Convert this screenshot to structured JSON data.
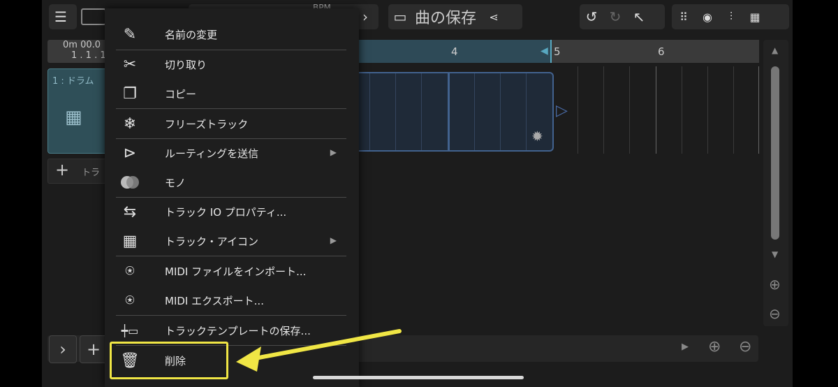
{
  "toolbar": {
    "song_title": "曲の保存",
    "bpm_label": "BPM"
  },
  "time": {
    "elapsed": "0m 00.0",
    "position": "1 . 1 . 1"
  },
  "ruler": {
    "marks": [
      "4",
      "5",
      "6"
    ]
  },
  "track": {
    "name": "1 : ドラム",
    "add_label": "トラ"
  },
  "menu": {
    "items": [
      {
        "label": "名前の変更",
        "icon": "pencil-icon"
      },
      {
        "label": "切り取り",
        "icon": "scissors-icon"
      },
      {
        "label": "コピー",
        "icon": "copy-icon"
      },
      {
        "label": "フリーズトラック",
        "icon": "snowflake-icon"
      },
      {
        "label": "ルーティングを送信",
        "icon": "routing-icon",
        "submenu": true
      },
      {
        "label": "モノ",
        "icon": "mono-icon"
      },
      {
        "label": "トラック IO プロパティ...",
        "icon": "io-cable-icon"
      },
      {
        "label": "トラック・アイコン",
        "icon": "grid-icon",
        "submenu": true
      },
      {
        "label": "MIDI ファイルをインポート...",
        "icon": "midi-import-icon"
      },
      {
        "label": "MIDI エクスポート...",
        "icon": "midi-export-icon"
      },
      {
        "label": "トラックテンプレートの保存...",
        "icon": "template-icon"
      },
      {
        "label": "削除",
        "icon": "trash-icon"
      }
    ]
  },
  "colors": {
    "highlight": "#f0e645",
    "clip_border": "#42628e",
    "track_header": "#2f4f58"
  }
}
